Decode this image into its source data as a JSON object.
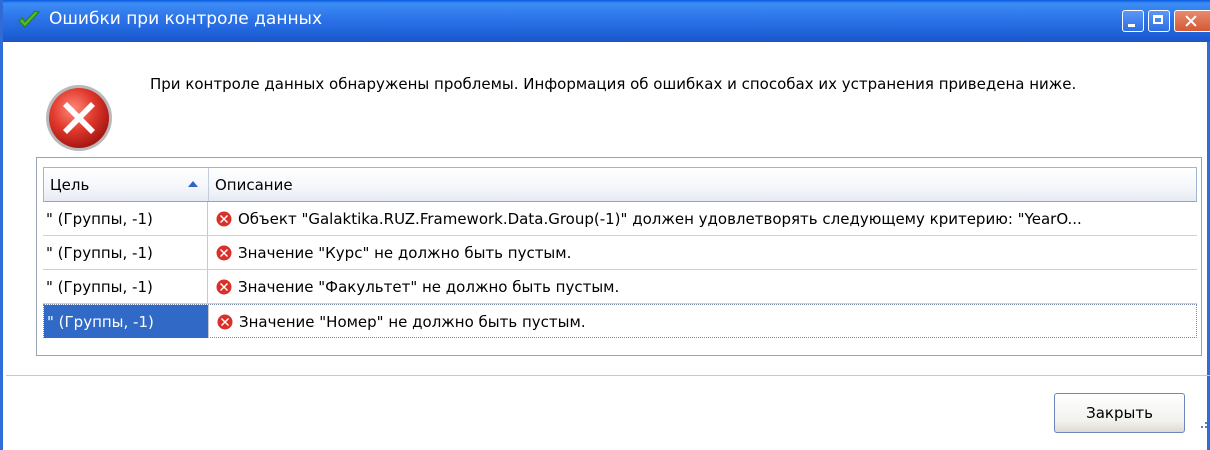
{
  "window": {
    "title": "Ошибки при контроле данных"
  },
  "colors": {
    "titlebar": "#2c73e8",
    "selection": "#3169c6",
    "error_red": "#d9302a"
  },
  "icons": {
    "title": "green-checkmark-icon",
    "message": "error-circle-icon",
    "row": "error-small-icon"
  },
  "message": "При контроле данных обнаружены проблемы. Информация об ошибках и способах их устранения приведена ниже.",
  "grid": {
    "columns": [
      {
        "label": "Цель",
        "sort": "ascending"
      },
      {
        "label": "Описание"
      }
    ],
    "rows": [
      {
        "target": "\" (Группы, -1)",
        "description": "Объект \"Galaktika.RUZ.Framework.Data.Group(-1)\" должен удовлетворять следующему критерию: \"YearO..."
      },
      {
        "target": "\" (Группы, -1)",
        "description": "Значение \"Курс\" не должно быть пустым."
      },
      {
        "target": "\" (Группы, -1)",
        "description": "Значение \"Факультет\" не должно быть пустым."
      },
      {
        "target": "\" (Группы, -1)",
        "description": "Значение \"Номер\" не должно быть пустым.",
        "selected": true
      }
    ]
  },
  "buttons": {
    "close": "Закрыть"
  }
}
